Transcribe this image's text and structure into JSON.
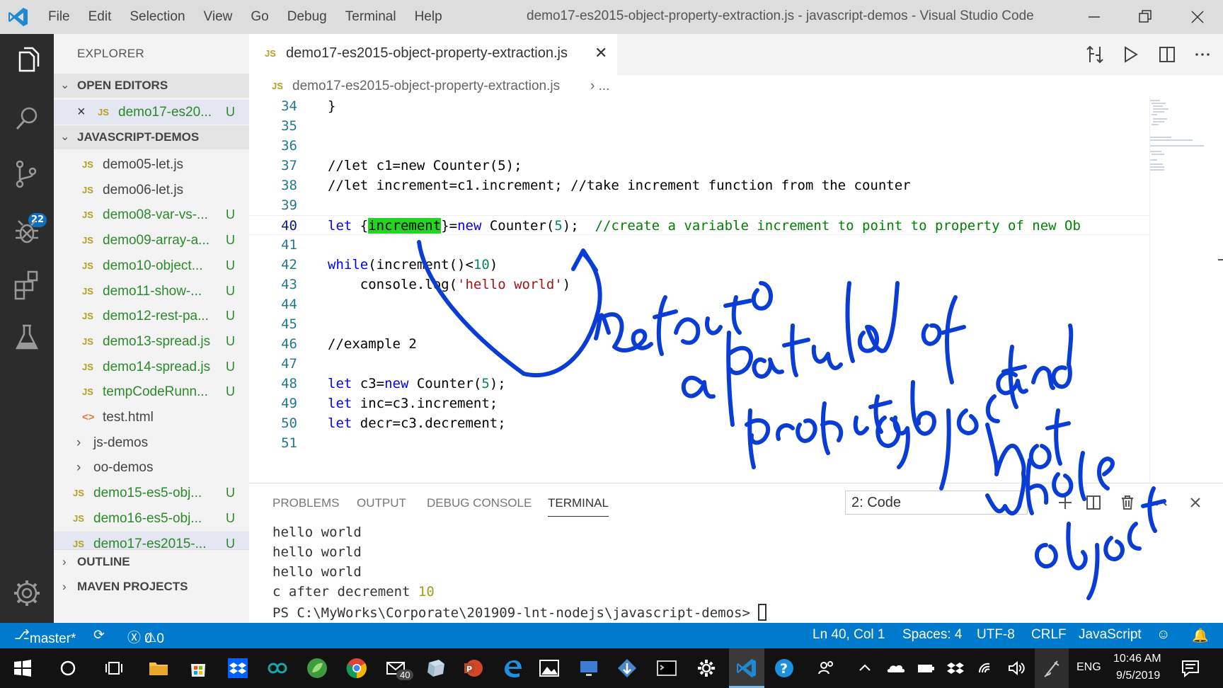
{
  "titlebar": {
    "menu": [
      "File",
      "Edit",
      "Selection",
      "View",
      "Go",
      "Debug",
      "Terminal",
      "Help"
    ],
    "window_title": "demo17-es2015-object-property-extraction.js - javascript-demos - Visual Studio Code",
    "minimize_icon": "minimize-icon",
    "restore_icon": "restore-icon",
    "close_icon": "close-icon"
  },
  "activity": {
    "scm_badge": "22"
  },
  "sidebar": {
    "title": "EXPLORER",
    "open_editors": "OPEN EDITORS",
    "open_editor_file": "demo17-es20...",
    "open_editor_status": "U",
    "project": "JAVASCRIPT-DEMOS",
    "files": [
      {
        "icon": "JS",
        "name": "demo05-let.js",
        "status": ""
      },
      {
        "icon": "JS",
        "name": "demo06-let.js",
        "status": ""
      },
      {
        "icon": "JS",
        "name": "demo08-var-vs-...",
        "status": "U"
      },
      {
        "icon": "JS",
        "name": "demo09-array-a...",
        "status": "U"
      },
      {
        "icon": "JS",
        "name": "demo10-object...",
        "status": "U"
      },
      {
        "icon": "JS",
        "name": "demo11-show-...",
        "status": "U"
      },
      {
        "icon": "JS",
        "name": "demo12-rest-pa...",
        "status": "U"
      },
      {
        "icon": "JS",
        "name": "demo13-spread.js",
        "status": "U"
      },
      {
        "icon": "JS",
        "name": "demo14-spread.js",
        "status": "U"
      },
      {
        "icon": "JS",
        "name": "tempCodeRunn...",
        "status": "U"
      },
      {
        "icon": "<>",
        "name": "test.html",
        "status": ""
      }
    ],
    "folders": [
      "js-demos",
      "oo-demos"
    ],
    "root_files": [
      {
        "icon": "JS",
        "name": "demo15-es5-obj...",
        "status": "U"
      },
      {
        "icon": "JS",
        "name": "demo16-es5-obj...",
        "status": "U"
      },
      {
        "icon": "JS",
        "name": "demo17-es2015-...",
        "status": "U"
      }
    ],
    "outline": "OUTLINE",
    "maven": "MAVEN PROJECTS"
  },
  "editor": {
    "tab_label": "demo17-es2015-object-property-extraction.js",
    "tab_icon": "JS",
    "breadcrumb_file": "demo17-es2015-object-property-extraction.js",
    "breadcrumb_more": "...",
    "line_numbers": [
      "34",
      "35",
      "36",
      "37",
      "38",
      "39",
      "40",
      "41",
      "42",
      "43",
      "44",
      "45",
      "46",
      "47",
      "48",
      "49",
      "50",
      "51"
    ],
    "code": {
      "l34": "}",
      "l37": "//let c1=new Counter(5);",
      "l38": "//let increment=c1.increment; //take increment function from the counter",
      "l40_kw": "let",
      "l40_open": " {",
      "l40_hl": "increment",
      "l40_close": "}=",
      "l40_new": "new",
      "l40_counter": " Counter(",
      "l40_num": "5",
      "l40_end": ");  ",
      "l40_comment": "//create a variable increment to point to property of new Ob",
      "l42_kw": "while",
      "l42_a": "(increment()<",
      "l42_num": "10",
      "l42_b": ")",
      "l43_a": "    console.log(",
      "l43_str": "'hello world'",
      "l43_b": ")",
      "l46": "//example 2",
      "l48_kw": "let",
      "l48_a": " c3=",
      "l48_new": "new",
      "l48_b": " Counter(",
      "l48_num": "5",
      "l48_c": ");",
      "l49_kw": "let",
      "l49_a": " inc=c3.increment;",
      "l50_kw": "let",
      "l50_a": " decr=c3.decrement;"
    }
  },
  "panel": {
    "tabs": [
      "PROBLEMS",
      "OUTPUT",
      "DEBUG CONSOLE",
      "TERMINAL"
    ],
    "terminal_select": "2: Code",
    "output": [
      "hello world",
      "hello world",
      "hello world"
    ],
    "decrement_label": "c after decrement ",
    "decrement_value": "10",
    "prompt": "PS C:\\MyWorks\\Corporate\\201909-lnt-nodejs\\javascript-demos> "
  },
  "statusbar": {
    "branch": "master*",
    "errors": "0",
    "warnings": "0",
    "position": "Ln 40, Col 1",
    "spaces": "Spaces: 4",
    "encoding": "UTF-8",
    "eol": "CRLF",
    "language": "JavaScript"
  },
  "taskbar": {
    "mail_badge": "40",
    "language": "ENG",
    "time": "10:46 AM",
    "date": "9/5/2019"
  },
  "colors": {
    "accent": "#007acc",
    "ink": "#0a3cd6",
    "highlight": "#22d622"
  }
}
